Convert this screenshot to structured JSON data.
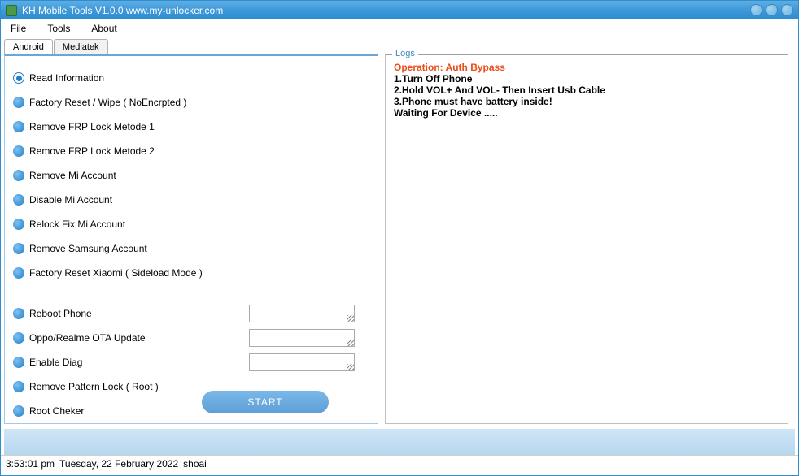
{
  "titlebar": {
    "title": "KH Mobile Tools V1.0.0 www.my-unlocker.com"
  },
  "menu": {
    "file": "File",
    "tools": "Tools",
    "about": "About"
  },
  "tabs": {
    "android": "Android",
    "mediatek": "Mediatek"
  },
  "options": [
    {
      "label": "Read Information",
      "selected": true,
      "has_input": false
    },
    {
      "label": "Factory Reset / Wipe ( NoEncrpted )",
      "selected": false,
      "has_input": false
    },
    {
      "label": "Remove FRP Lock Metode 1",
      "selected": false,
      "has_input": false
    },
    {
      "label": "Remove FRP Lock Metode 2",
      "selected": false,
      "has_input": false
    },
    {
      "label": "Remove Mi Account",
      "selected": false,
      "has_input": false
    },
    {
      "label": "Disable Mi Account",
      "selected": false,
      "has_input": false
    },
    {
      "label": "Relock Fix Mi Account",
      "selected": false,
      "has_input": false
    },
    {
      "label": "Remove Samsung Account",
      "selected": false,
      "has_input": false
    },
    {
      "label": "Factory Reset Xiaomi ( Sideload Mode )",
      "selected": false,
      "has_input": false
    },
    {
      "label": "Reboot Phone",
      "selected": false,
      "has_input": true,
      "value": ""
    },
    {
      "label": "Oppo/Realme OTA Update",
      "selected": false,
      "has_input": true,
      "value": ""
    },
    {
      "label": "Enable Diag",
      "selected": false,
      "has_input": true,
      "value": ""
    },
    {
      "label": "Remove Pattern Lock ( Root )",
      "selected": false,
      "has_input": false
    },
    {
      "label": "Root Cheker",
      "selected": false,
      "has_input": false
    }
  ],
  "start_label": "START",
  "logs": {
    "legend": "Logs",
    "operation": "Operation: Auth Bypass",
    "step1": "1.Turn Off Phone",
    "step2": "2.Hold VOL+ And VOL- Then Insert Usb Cable",
    "step3": "3.Phone must have battery inside!",
    "waiting": "Waiting For Device ....."
  },
  "status": {
    "time": "3:53:01 pm",
    "date": "Tuesday, 22 February 2022",
    "user": "shoai"
  }
}
